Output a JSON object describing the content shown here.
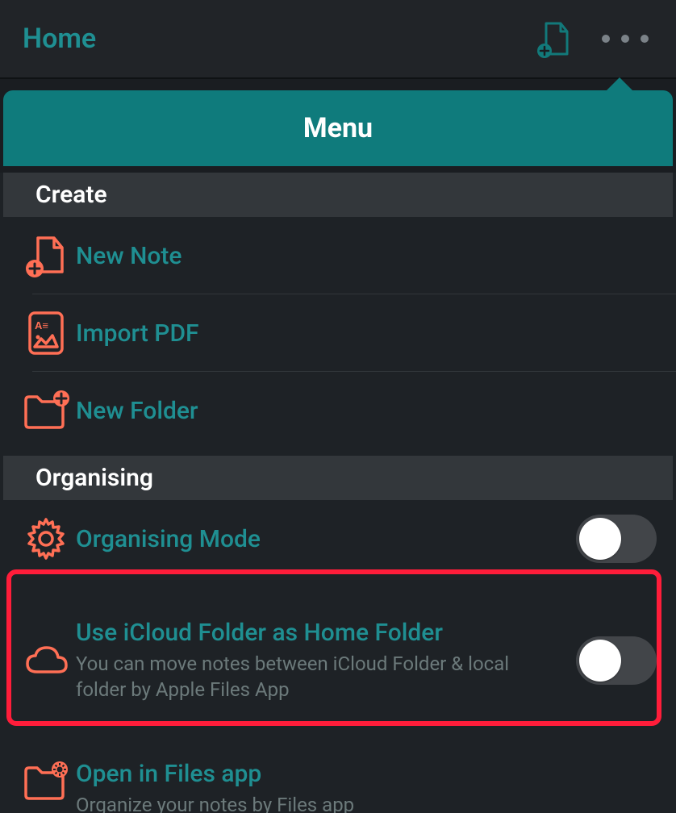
{
  "topbar": {
    "title": "Home"
  },
  "menu": {
    "title": "Menu",
    "sections": {
      "create": {
        "header": "Create",
        "items": {
          "new_note": "New Note",
          "import_pdf": "Import PDF",
          "new_folder": "New Folder"
        }
      },
      "organising": {
        "header": "Organising",
        "items": {
          "organising_mode": {
            "label": "Organising Mode",
            "toggle_on": false
          },
          "icloud": {
            "label": "Use iCloud Folder as Home Folder",
            "sub": "You can move notes between iCloud Folder & local folder by Apple Files App",
            "toggle_on": false
          },
          "files_app": {
            "label": "Open in Files app",
            "sub": "Organize your notes by Files app"
          }
        }
      }
    }
  }
}
